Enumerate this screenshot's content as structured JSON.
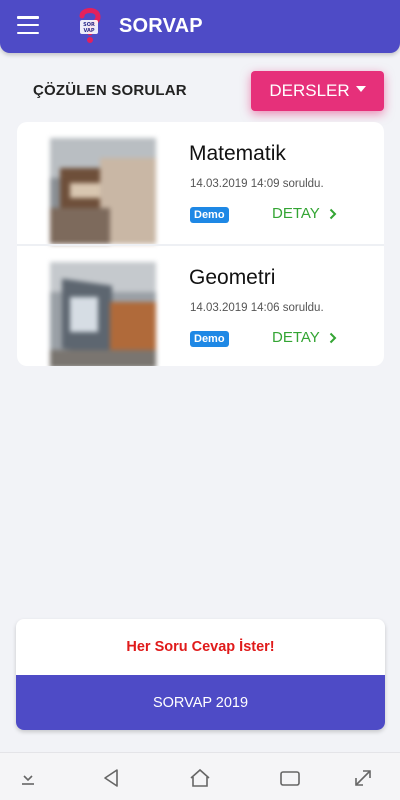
{
  "app": {
    "title": "SORVAP",
    "colors": {
      "primary": "#4e4bc6",
      "accent": "#e6307a",
      "success": "#34a534",
      "badge": "#1e88e5",
      "slogan": "#e01b1b"
    }
  },
  "header": {
    "menu_icon": "hamburger-menu-icon",
    "logo_icon": "sorvap-logo-icon"
  },
  "section": {
    "title": "ÇÖZÜLEN SORULAR",
    "filter_button": "DERSLER",
    "filter_caret_icon": "caret-down-icon"
  },
  "questions": [
    {
      "subject": "Matematik",
      "date": "14.03.2019 14:09 soruldu.",
      "badge": "Demo",
      "action": "DETAY"
    },
    {
      "subject": "Geometri",
      "date": "14.03.2019 14:06 soruldu.",
      "badge": "Demo",
      "action": "DETAY"
    }
  ],
  "footer": {
    "slogan": "Her Soru Cevap İster!",
    "bar_text": "SORVAP 2019"
  },
  "navbar": {
    "icons": [
      "hide-keyboard-icon",
      "back-icon",
      "home-icon",
      "recent-apps-icon",
      "expand-icon"
    ]
  }
}
